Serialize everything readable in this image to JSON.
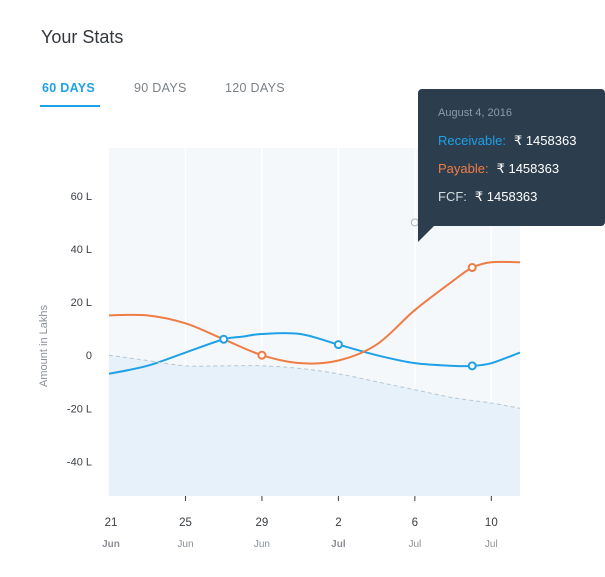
{
  "header": {
    "title": "Your Stats"
  },
  "tabs": [
    {
      "label": "60 DAYS",
      "active": true
    },
    {
      "label": "90 DAYS",
      "active": false
    },
    {
      "label": "120 DAYS",
      "active": false
    }
  ],
  "colors": {
    "accent": "#1ea1e6",
    "receivable": "#1ea1e6",
    "payable": "#ef7c45",
    "fcf": "#b7c7d3",
    "tooltip_bg": "#2c3e4e"
  },
  "tooltip": {
    "date": "August 4, 2016",
    "rows": [
      {
        "label": "Receivable:",
        "value": "₹ 1458363"
      },
      {
        "label": "Payable:",
        "value": "₹ 1458363"
      },
      {
        "label": "FCF:",
        "value": "₹ 1458363"
      }
    ]
  },
  "chart_data": {
    "type": "line",
    "ylabel": "Amount in Lakhs",
    "y_ticks": [
      {
        "value": 60,
        "label": "60 L"
      },
      {
        "value": 40,
        "label": "40 L"
      },
      {
        "value": 20,
        "label": "20 L"
      },
      {
        "value": 0,
        "label": "0"
      },
      {
        "value": -20,
        "label": "-20 L"
      },
      {
        "value": -40,
        "label": "-40 L"
      }
    ],
    "ylim": [
      -53,
      78
    ],
    "x_ticks": [
      {
        "day": "21",
        "month": "Jun",
        "bold": true,
        "x": 0
      },
      {
        "day": "25",
        "month": "Jun",
        "bold": false,
        "x": 4
      },
      {
        "day": "29",
        "month": "Jun",
        "bold": false,
        "x": 8
      },
      {
        "day": "2",
        "month": "Jul",
        "bold": true,
        "x": 12
      },
      {
        "day": "6",
        "month": "Jul",
        "bold": false,
        "x": 16
      },
      {
        "day": "10",
        "month": "Jul",
        "bold": false,
        "x": 20
      }
    ],
    "xlim": [
      0,
      21.5
    ],
    "series": [
      {
        "key": "receivable",
        "x": [
          0,
          2,
          4,
          6,
          7,
          8,
          10,
          12,
          14,
          16,
          18,
          19,
          20,
          21.5
        ],
        "y": [
          -7,
          -4,
          1,
          6,
          7,
          8,
          8,
          4,
          0,
          -3,
          -4,
          -4,
          -3,
          1
        ]
      },
      {
        "key": "payable",
        "x": [
          0,
          2,
          4,
          6,
          8,
          10,
          12,
          14,
          16,
          18,
          19,
          20,
          21.5
        ],
        "y": [
          15,
          15,
          12,
          6,
          0,
          -3,
          -2,
          4,
          17,
          28,
          33,
          35,
          35
        ]
      },
      {
        "key": "fcf",
        "x": [
          0,
          2,
          4,
          6,
          8,
          10,
          12,
          14,
          16,
          18,
          20,
          21.5
        ],
        "y": [
          0,
          -2,
          -4,
          -4,
          -4,
          -5,
          -7,
          -10,
          -13,
          -16,
          -18,
          -20
        ]
      }
    ],
    "markers": [
      {
        "key": "receivable",
        "x": 6,
        "y": 6
      },
      {
        "key": "receivable",
        "x": 12,
        "y": 4
      },
      {
        "key": "receivable",
        "x": 19,
        "y": -4
      },
      {
        "key": "payable",
        "x": 8,
        "y": 0
      },
      {
        "key": "payable",
        "x": 19,
        "y": 33
      },
      {
        "key": "fcf",
        "x": 16,
        "y": 50
      }
    ]
  }
}
